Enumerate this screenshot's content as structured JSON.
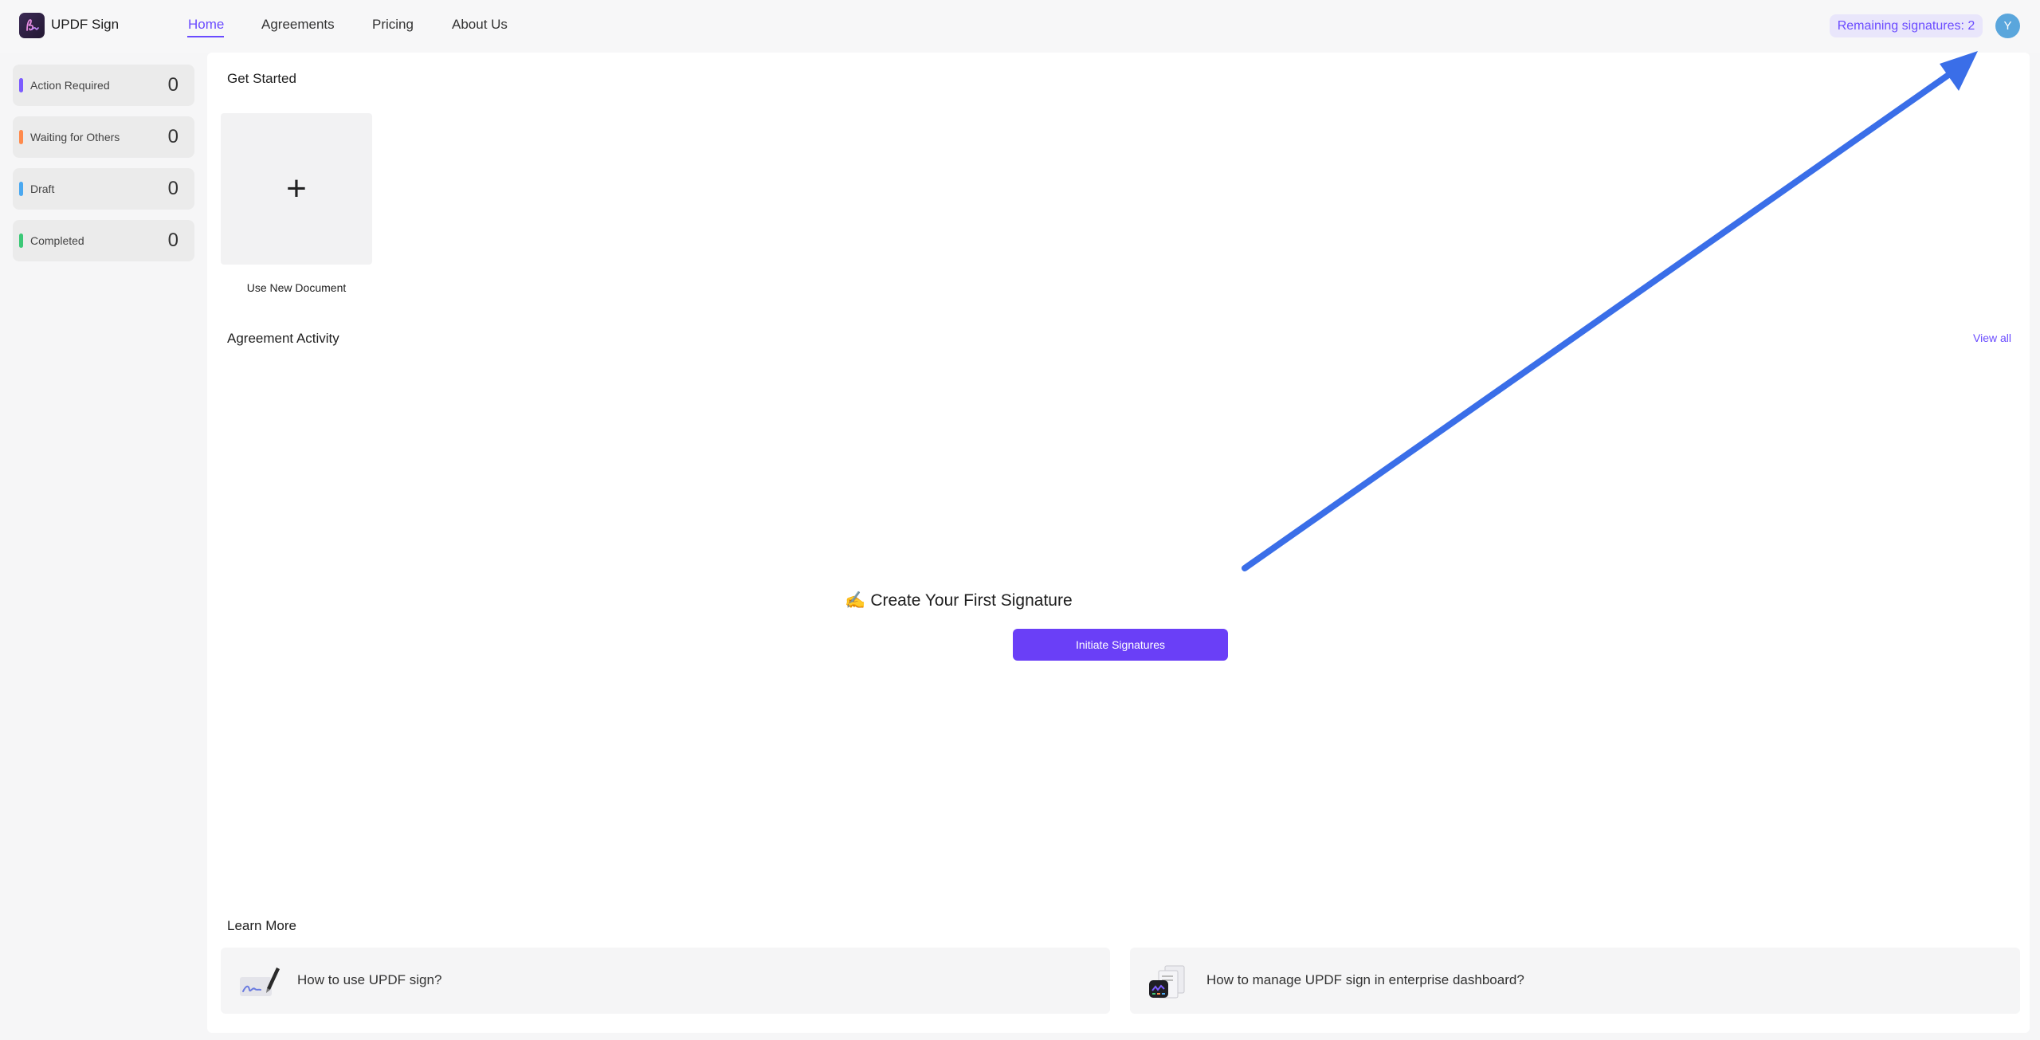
{
  "app": {
    "name": "UPDF Sign"
  },
  "nav": {
    "items": [
      {
        "label": "Home",
        "active": true
      },
      {
        "label": "Agreements",
        "active": false
      },
      {
        "label": "Pricing",
        "active": false
      },
      {
        "label": "About Us",
        "active": false
      }
    ]
  },
  "header": {
    "remaining_signatures": "Remaining signatures: 2",
    "avatar_initial": "Y"
  },
  "sidebar": {
    "items": [
      {
        "label": "Action Required",
        "count": "0",
        "color": "#7c5cff"
      },
      {
        "label": "Waiting for Others",
        "count": "0",
        "color": "#ff8a4c"
      },
      {
        "label": "Draft",
        "count": "0",
        "color": "#4aa8f0"
      },
      {
        "label": "Completed",
        "count": "0",
        "color": "#3cc877"
      }
    ]
  },
  "get_started": {
    "title": "Get Started",
    "new_document_label": "Use New Document",
    "plus_glyph": "+"
  },
  "activity": {
    "title": "Agreement Activity",
    "view_all": "View all",
    "empty_emoji": "✍️",
    "empty_title": "Create Your First Signature",
    "initiate_button": "Initiate Signatures"
  },
  "learn_more": {
    "title": "Learn More",
    "cards": [
      {
        "text": "How to use UPDF sign?",
        "icon": "signature-pen-icon"
      },
      {
        "text": "How to manage UPDF sign in enterprise dashboard?",
        "icon": "enterprise-dashboard-icon"
      }
    ]
  },
  "annotation": {
    "arrow_color": "#3a6ee8"
  }
}
